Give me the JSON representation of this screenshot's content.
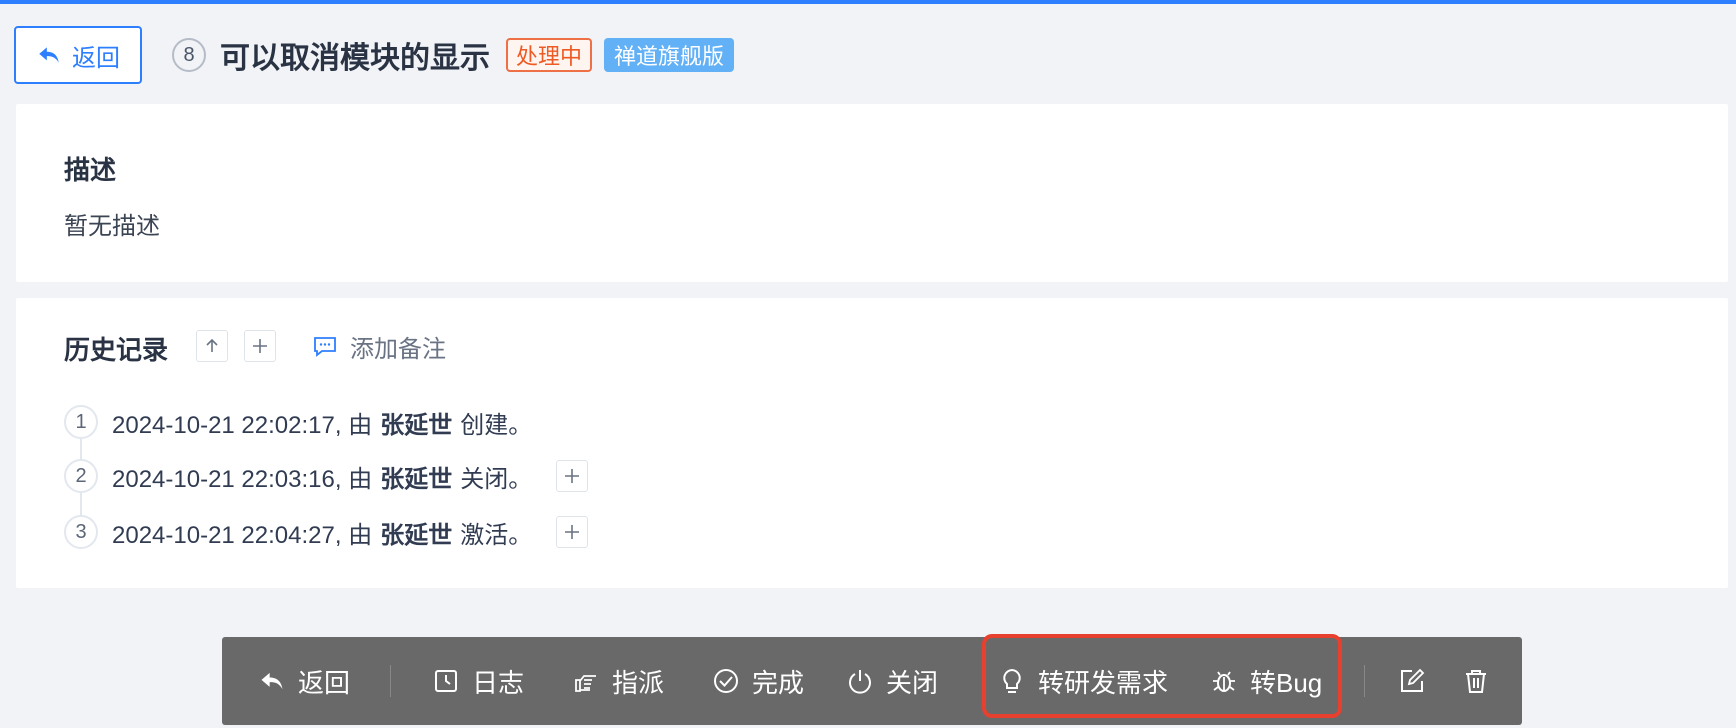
{
  "header": {
    "back_label": "返回",
    "id": "8",
    "title": "可以取消模块的显示",
    "status": "处理中",
    "edition": "禅道旗舰版"
  },
  "description": {
    "title": "描述",
    "text": "暂无描述"
  },
  "history": {
    "title": "历史记录",
    "add_note_label": "添加备注",
    "items": [
      {
        "num": "1",
        "time": "2024-10-21 22:02:17, 由",
        "user": "张延世",
        "action": "创建。"
      },
      {
        "num": "2",
        "time": "2024-10-21 22:03:16, 由",
        "user": "张延世",
        "action": "关闭。"
      },
      {
        "num": "3",
        "time": "2024-10-21 22:04:27, 由",
        "user": "张延世",
        "action": "激活。"
      }
    ]
  },
  "toolbar": {
    "back": "返回",
    "log": "日志",
    "assign": "指派",
    "finish": "完成",
    "close": "关闭",
    "to_story": "转研发需求",
    "to_bug": "转Bug"
  },
  "colors": {
    "accent": "#2e7fff",
    "status": "#ee5a24",
    "edition": "#62b0f5",
    "toolbar": "#696969",
    "highlight": "#e8402f"
  }
}
